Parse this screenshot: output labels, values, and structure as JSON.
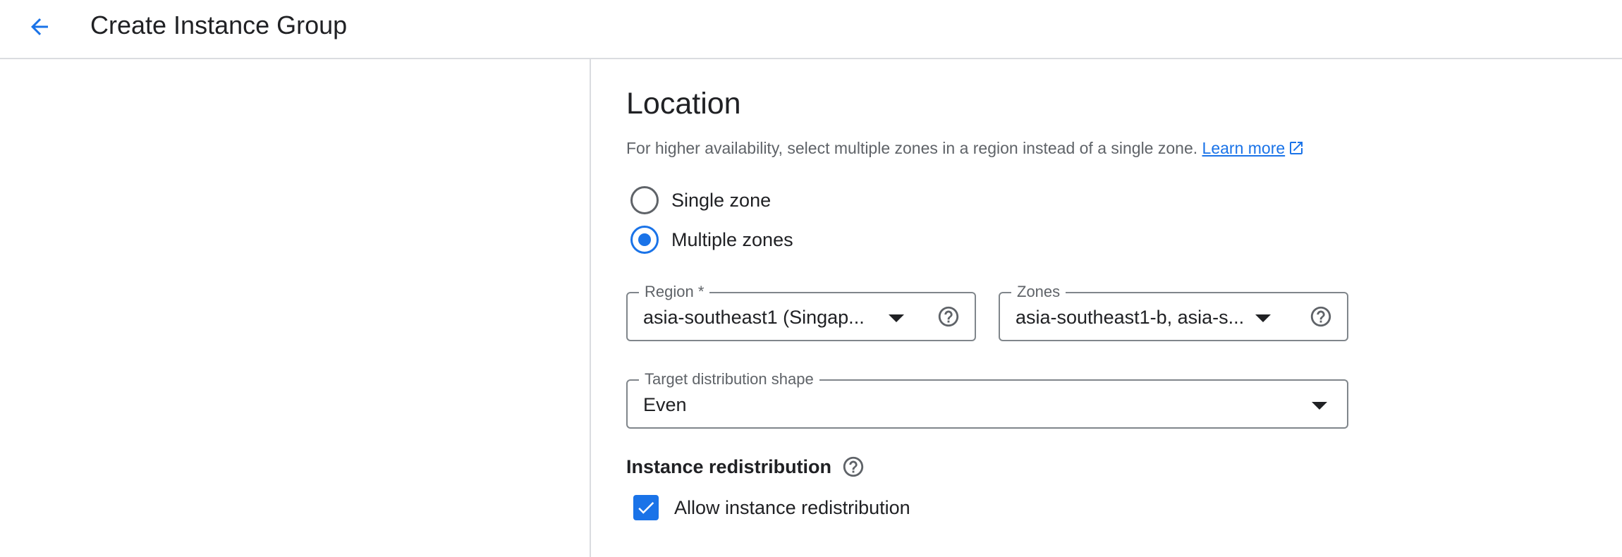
{
  "header": {
    "title": "Create Instance Group",
    "back_icon": "arrow-back-icon"
  },
  "location": {
    "title": "Location",
    "description": "For higher availability, select multiple zones in a region instead of a single zone.",
    "learn_more": "Learn more",
    "options": [
      {
        "label": "Single zone",
        "selected": false
      },
      {
        "label": "Multiple zones",
        "selected": true
      }
    ],
    "region": {
      "label": "Region *",
      "value": "asia-southeast1 (Singap..."
    },
    "zones": {
      "label": "Zones",
      "value": "asia-southeast1-b, asia-s..."
    },
    "distribution": {
      "label": "Target distribution shape",
      "value": "Even"
    }
  },
  "redistribution": {
    "title": "Instance redistribution",
    "checkbox_label": "Allow instance redistribution",
    "checked": true
  },
  "colors": {
    "accent": "#1a73e8",
    "text": "#202124",
    "secondary_text": "#5f6368",
    "border": "#dadce0"
  }
}
